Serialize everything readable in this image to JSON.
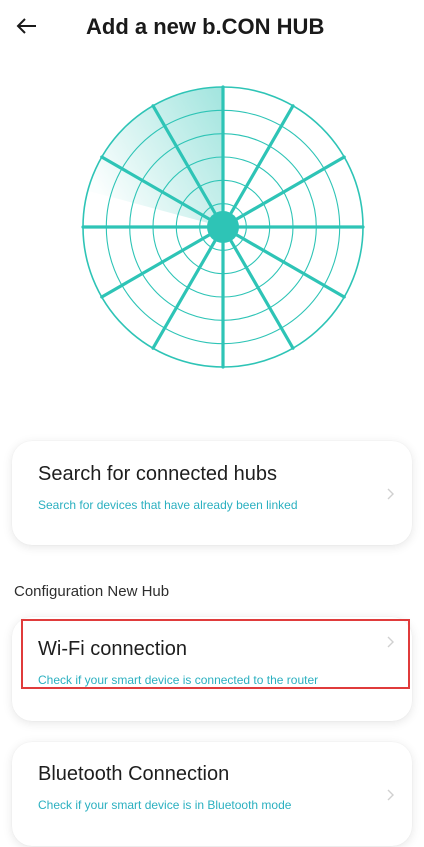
{
  "header": {
    "title": "Add a new b.CON HUB"
  },
  "colors": {
    "accent": "#2ec4b6",
    "subtitle_text": "#2bb0c0",
    "highlight_border": "#e03b3b"
  },
  "icons": {
    "back": "arrow-left-icon",
    "chevron": "chevron-right-icon",
    "radar": "radar-scan-icon"
  },
  "search_card": {
    "title": "Search for connected hubs",
    "subtitle": "Search for devices that have already been linked"
  },
  "section": {
    "label": "Configuration New Hub"
  },
  "wifi_card": {
    "title": "Wi-Fi connection",
    "subtitle": "Check if your smart device is connected to the router"
  },
  "bluetooth_card": {
    "title": "Bluetooth Connection",
    "subtitle": "Check if your smart device is in Bluetooth mode"
  }
}
